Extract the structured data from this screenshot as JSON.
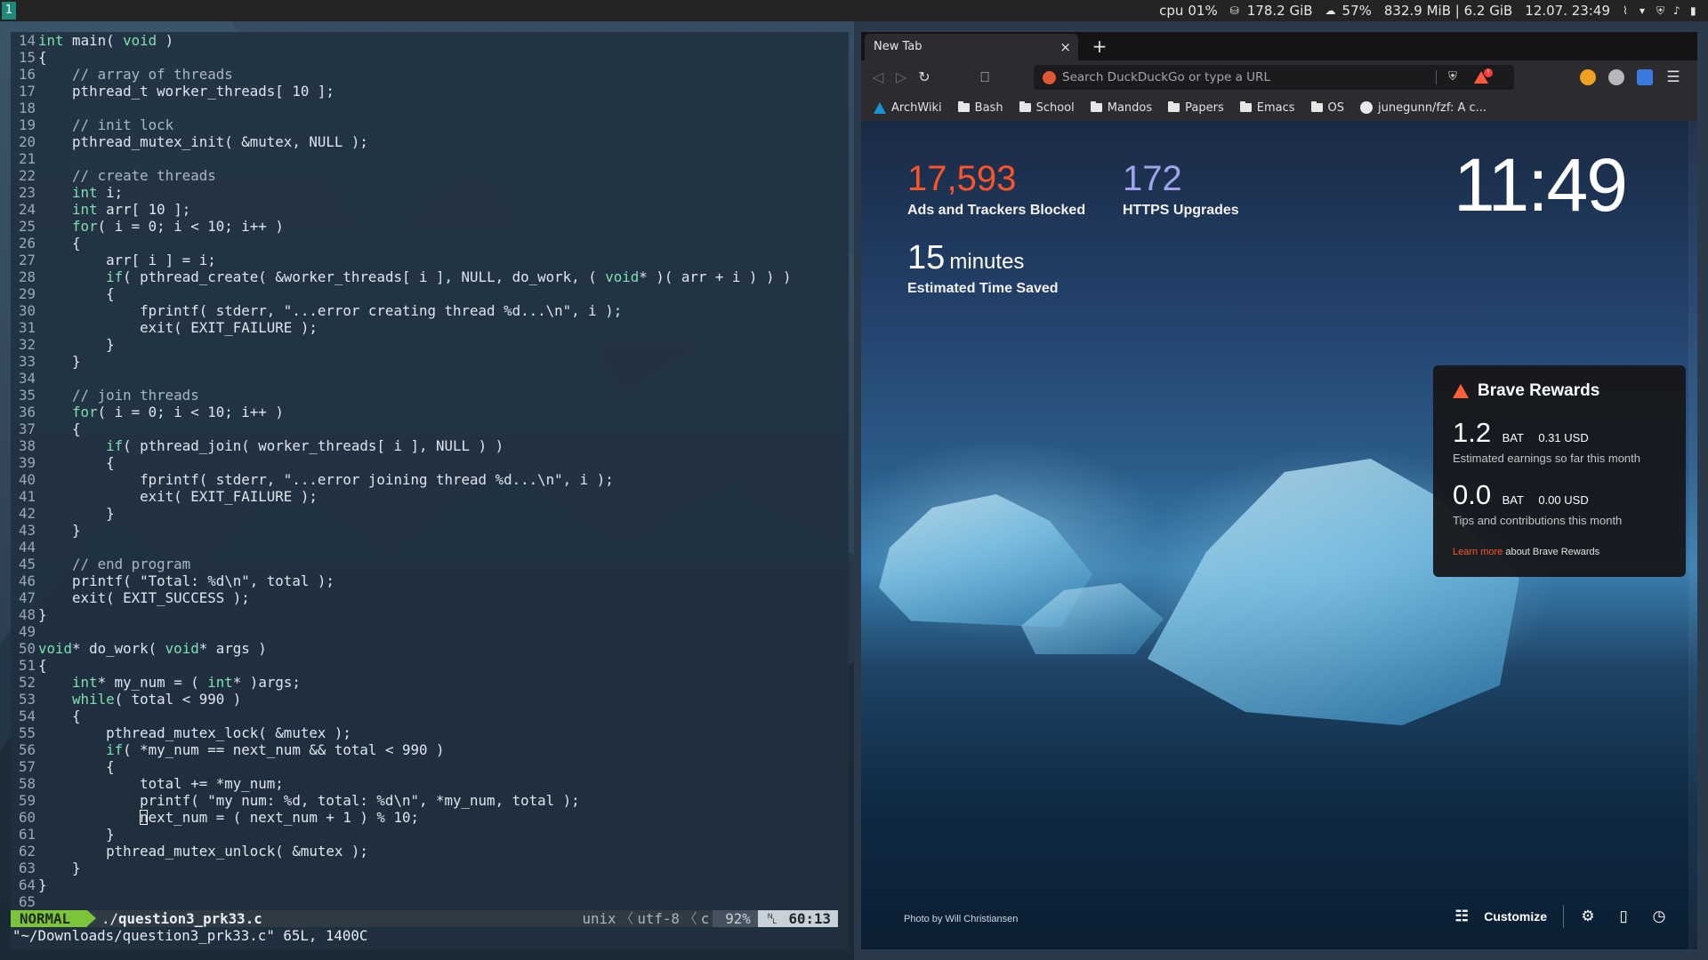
{
  "topbar": {
    "workspace": "1",
    "cpu_label": "cpu",
    "cpu_value": "01%",
    "disk": "178.2 GiB",
    "weather": "57%",
    "memory": "832.9 MiB | 6.2 GiB",
    "datetime": "12.07. 23:49",
    "tray_icons": [
      "attachment-icon",
      "wifi-icon",
      "shield-icon",
      "volume-icon",
      "battery-icon"
    ]
  },
  "vim": {
    "lines": [
      {
        "n": "14",
        "t": "int main( void )"
      },
      {
        "n": "15",
        "t": "{"
      },
      {
        "n": "16",
        "t": "    // array of threads"
      },
      {
        "n": "17",
        "t": "    pthread_t worker_threads[ 10 ];"
      },
      {
        "n": "18",
        "t": ""
      },
      {
        "n": "19",
        "t": "    // init lock"
      },
      {
        "n": "20",
        "t": "    pthread_mutex_init( &mutex, NULL );"
      },
      {
        "n": "21",
        "t": ""
      },
      {
        "n": "22",
        "t": "    // create threads"
      },
      {
        "n": "23",
        "t": "    int i;"
      },
      {
        "n": "24",
        "t": "    int arr[ 10 ];"
      },
      {
        "n": "25",
        "t": "    for( i = 0; i < 10; i++ )"
      },
      {
        "n": "26",
        "t": "    {"
      },
      {
        "n": "27",
        "t": "        arr[ i ] = i;"
      },
      {
        "n": "28",
        "t": "        if( pthread_create( &worker_threads[ i ], NULL, do_work, ( void* )( arr + i ) ) )"
      },
      {
        "n": "29",
        "t": "        {"
      },
      {
        "n": "30",
        "t": "            fprintf( stderr, \"...error creating thread %d...\\n\", i );"
      },
      {
        "n": "31",
        "t": "            exit( EXIT_FAILURE );"
      },
      {
        "n": "32",
        "t": "        }"
      },
      {
        "n": "33",
        "t": "    }"
      },
      {
        "n": "34",
        "t": ""
      },
      {
        "n": "35",
        "t": "    // join threads"
      },
      {
        "n": "36",
        "t": "    for( i = 0; i < 10; i++ )"
      },
      {
        "n": "37",
        "t": "    {"
      },
      {
        "n": "38",
        "t": "        if( pthread_join( worker_threads[ i ], NULL ) )"
      },
      {
        "n": "39",
        "t": "        {"
      },
      {
        "n": "40",
        "t": "            fprintf( stderr, \"...error joining thread %d...\\n\", i );"
      },
      {
        "n": "41",
        "t": "            exit( EXIT_FAILURE );"
      },
      {
        "n": "42",
        "t": "        }"
      },
      {
        "n": "43",
        "t": "    }"
      },
      {
        "n": "44",
        "t": ""
      },
      {
        "n": "45",
        "t": "    // end program"
      },
      {
        "n": "46",
        "t": "    printf( \"Total: %d\\n\", total );"
      },
      {
        "n": "47",
        "t": "    exit( EXIT_SUCCESS );"
      },
      {
        "n": "48",
        "t": "}"
      },
      {
        "n": "49",
        "t": ""
      },
      {
        "n": "50",
        "t": "void* do_work( void* args )"
      },
      {
        "n": "51",
        "t": "{"
      },
      {
        "n": "52",
        "t": "    int* my_num = ( int* )args;"
      },
      {
        "n": "53",
        "t": "    while( total < 990 )"
      },
      {
        "n": "54",
        "t": "    {"
      },
      {
        "n": "55",
        "t": "        pthread_mutex_lock( &mutex );"
      },
      {
        "n": "56",
        "t": "        if( *my_num == next_num && total < 990 )"
      },
      {
        "n": "57",
        "t": "        {"
      },
      {
        "n": "58",
        "t": "            total += *my_num;"
      },
      {
        "n": "59",
        "t": "            printf( \"my num: %d, total: %d\\n\", *my_num, total );"
      },
      {
        "n": "60",
        "t": "            next_num = ( next_num + 1 ) % 10;"
      },
      {
        "n": "61",
        "t": "        }"
      },
      {
        "n": "62",
        "t": "        pthread_mutex_unlock( &mutex );"
      },
      {
        "n": "63",
        "t": "    }"
      },
      {
        "n": "64",
        "t": "}"
      },
      {
        "n": "65",
        "t": ""
      }
    ],
    "statusline": {
      "mode": "NORMAL",
      "path_prefix": "./",
      "filename": "question3_prk33.c",
      "fileformat": "unix",
      "encoding": "utf-8",
      "filetype": "c",
      "percent": "92%",
      "line_icon": "␤",
      "position": "60:13"
    },
    "cmdline": "\"~/Downloads/question3_prk33.c\" 65L, 1400C"
  },
  "browser": {
    "tab_title": "New Tab",
    "tab_close": "×",
    "new_tab": "+",
    "url_placeholder": "Search DuckDuckGo or type a URL",
    "bookmarks": [
      {
        "label": "ArchWiki",
        "icon": "archlinux-icon"
      },
      {
        "label": "Bash",
        "icon": "folder-icon"
      },
      {
        "label": "School",
        "icon": "folder-icon"
      },
      {
        "label": "Mandos",
        "icon": "folder-icon"
      },
      {
        "label": "Papers",
        "icon": "folder-icon"
      },
      {
        "label": "Emacs",
        "icon": "folder-icon"
      },
      {
        "label": "OS",
        "icon": "folder-icon"
      },
      {
        "label": "junegunn/fzf: A c...",
        "icon": "github-icon"
      }
    ],
    "ntp": {
      "ads_blocked": "17,593",
      "ads_blocked_label": "Ads and Trackers Blocked",
      "https_upgrades": "172",
      "https_upgrades_label": "HTTPS Upgrades",
      "time_saved": "15",
      "time_saved_unit": "minutes",
      "time_saved_label": "Estimated Time Saved",
      "clock": "11:49",
      "rewards": {
        "title": "Brave Rewards",
        "earnings_bat": "1.2",
        "earnings_unit": "BAT",
        "earnings_usd": "0.31 USD",
        "earnings_label": "Estimated earnings so far this month",
        "tips_bat": "0.0",
        "tips_unit": "BAT",
        "tips_usd": "0.00 USD",
        "tips_label": "Tips and contributions this month",
        "learn_more": "Learn more",
        "learn_more_rest": "about Brave Rewards"
      },
      "photo_by": "Photo by",
      "photographer": "Will Christiansen",
      "customize": "Customize"
    },
    "colors": {
      "accent_orange": "#fb542b",
      "https_purple": "#a0a5eb",
      "vim_mode_green": "#7cc43a"
    }
  }
}
